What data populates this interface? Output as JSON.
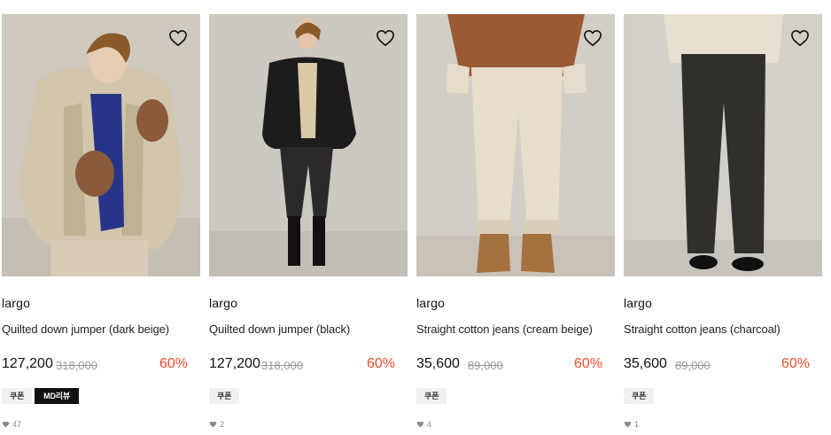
{
  "products": [
    {
      "brand": "largo",
      "title": "Quilted down jumper (dark beige)",
      "price": "127,200",
      "original_price": "318,000",
      "discount": "60%",
      "badges": [
        "쿠폰",
        "MD리뷰"
      ],
      "likes": "47",
      "wish_icon": "heart-outline-icon"
    },
    {
      "brand": "largo",
      "title": "Quilted down jumper (black)",
      "price": "127,200",
      "original_price": "318,000",
      "discount": "60%",
      "badges": [
        "쿠폰"
      ],
      "likes": "2",
      "wish_icon": "heart-outline-icon"
    },
    {
      "brand": "largo",
      "title": "Straight cotton jeans (cream beige)",
      "price": "35,600",
      "original_price": "89,000",
      "discount": "60%",
      "badges": [
        "쿠폰"
      ],
      "likes": "4",
      "wish_icon": "heart-outline-icon"
    },
    {
      "brand": "largo",
      "title": "Straight cotton jeans (charcoal)",
      "price": "35,600",
      "original_price": "89,000",
      "discount": "60%",
      "badges": [
        "쿠폰"
      ],
      "likes": "1",
      "wish_icon": "heart-outline-icon"
    }
  ],
  "colors": {
    "discount": "#ef4d2a",
    "photo_background": "#d6d1c8",
    "badge_background": "#f0f0f0",
    "badge_dark": "#111111"
  }
}
